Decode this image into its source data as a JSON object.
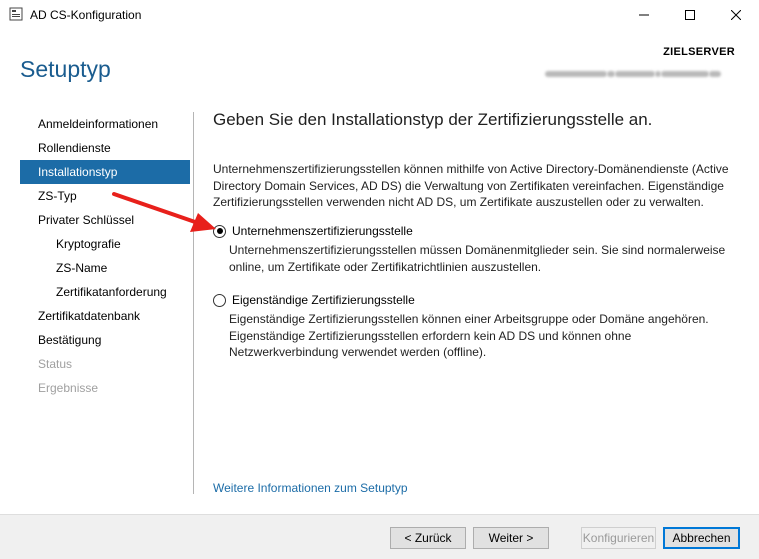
{
  "window": {
    "title": "AD CS-Konfiguration"
  },
  "controls": {
    "minimize": "–",
    "maximize": "☐",
    "close": "✕"
  },
  "header": {
    "title": "Setuptyp",
    "server_label": "ZIELSERVER"
  },
  "nav": {
    "items": [
      {
        "label": "Anmeldeinformationen",
        "state": "normal"
      },
      {
        "label": "Rollendienste",
        "state": "normal"
      },
      {
        "label": "Installationstyp",
        "state": "selected"
      },
      {
        "label": "ZS-Typ",
        "state": "normal"
      },
      {
        "label": "Privater Schlüssel",
        "state": "normal"
      },
      {
        "label": "Kryptografie",
        "state": "sub"
      },
      {
        "label": "ZS-Name",
        "state": "sub"
      },
      {
        "label": "Zertifikatanforderung",
        "state": "sub"
      },
      {
        "label": "Zertifikatdatenbank",
        "state": "normal"
      },
      {
        "label": "Bestätigung",
        "state": "normal"
      },
      {
        "label": "Status",
        "state": "disabled"
      },
      {
        "label": "Ergebnisse",
        "state": "disabled"
      }
    ]
  },
  "main": {
    "heading": "Geben Sie den Installationstyp der Zertifizierungsstelle an.",
    "intro": "Unternehmenszertifizierungsstellen können mithilfe von Active Directory-Domänendienste (Active Directory Domain Services, AD DS) die Verwaltung von Zertifikaten vereinfachen. Eigenständige Zertifizierungsstellen verwenden nicht AD DS, um Zertifikate auszustellen oder zu verwalten.",
    "options": [
      {
        "label": "Unternehmenszertifizierungsstelle",
        "checked": true,
        "description": "Unternehmenszertifizierungsstellen müssen Domänenmitglieder sein. Sie sind normalerweise online, um Zertifikate oder Zertifikatrichtlinien auszustellen."
      },
      {
        "label": "Eigenständige Zertifizierungsstelle",
        "checked": false,
        "description": "Eigenständige Zertifizierungsstellen können einer Arbeitsgruppe oder Domäne angehören. Eigenständige Zertifizierungsstellen erfordern kein AD DS und können ohne Netzwerkverbindung verwendet werden (offline)."
      }
    ],
    "more_link": "Weitere Informationen zum Setuptyp"
  },
  "footer": {
    "back": "< Zurück",
    "next": "Weiter >",
    "configure": "Konfigurieren",
    "cancel": "Abbrechen"
  },
  "colors": {
    "accent": "#1c6ca7",
    "title": "#1a5c8f",
    "annotation_arrow": "#e8201b"
  },
  "icons": {
    "app": "server-manager-icon",
    "annotation": "red-arrow-icon"
  }
}
